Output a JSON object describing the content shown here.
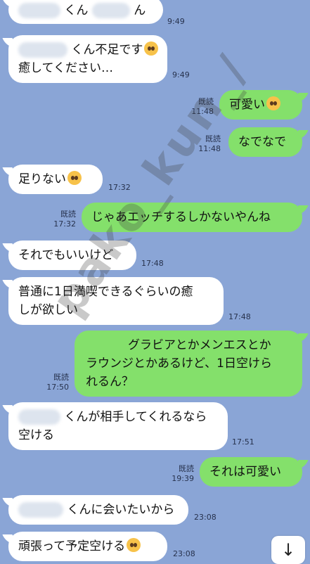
{
  "messages": [
    {
      "id": "m1",
      "side": "in",
      "pre": "",
      "mid": "くん",
      "post": "ん",
      "time": "9:49",
      "read": ""
    },
    {
      "id": "m2",
      "side": "in",
      "line1": "くん不足です",
      "line2": "癒してください…",
      "time": "9:49",
      "read": ""
    },
    {
      "id": "m3",
      "side": "out",
      "text": "可愛い",
      "time": "11:48",
      "read": "既読"
    },
    {
      "id": "m4",
      "side": "out",
      "text": "なでなで",
      "time": "11:48",
      "read": "既読"
    },
    {
      "id": "m5",
      "side": "in",
      "text": "足りない",
      "time": "17:32",
      "read": ""
    },
    {
      "id": "m6",
      "side": "out",
      "text": "じゃあエッチするしかないやんね",
      "time": "17:32",
      "read": "既読"
    },
    {
      "id": "m7",
      "side": "in",
      "text": "それでもいいけど",
      "time": "17:48",
      "read": ""
    },
    {
      "id": "m8",
      "side": "in",
      "line1": "普通に1日満喫できるぐらいの癒",
      "line2": "しが欲しい",
      "time": "17:48",
      "read": ""
    },
    {
      "id": "m9",
      "side": "out",
      "line1": "グラビアとかメンエスとか",
      "line2": "ラウンジとかあるけど、1日空けら",
      "line3": "れるん？",
      "time": "17:50",
      "read": "既読"
    },
    {
      "id": "m10",
      "side": "in",
      "line1": "くんが相手してくれるなら",
      "line2": "空ける",
      "time": "17:51",
      "read": ""
    },
    {
      "id": "m11",
      "side": "out",
      "text": "それは可愛い",
      "time": "19:39",
      "read": "既読"
    },
    {
      "id": "m12",
      "side": "in",
      "text": "くんに会いたいから",
      "time": "23:08",
      "read": ""
    },
    {
      "id": "m13",
      "side": "in",
      "text": "頑張って予定空ける",
      "time": "23:08",
      "read": ""
    }
  ],
  "watermark": "pako_kun_/",
  "scroll_button": {
    "icon": "arrow-down-icon",
    "glyph": "↓"
  },
  "colors": {
    "background": "#8aa5d6",
    "incoming": "#ffffff",
    "outgoing": "#84e06b"
  }
}
